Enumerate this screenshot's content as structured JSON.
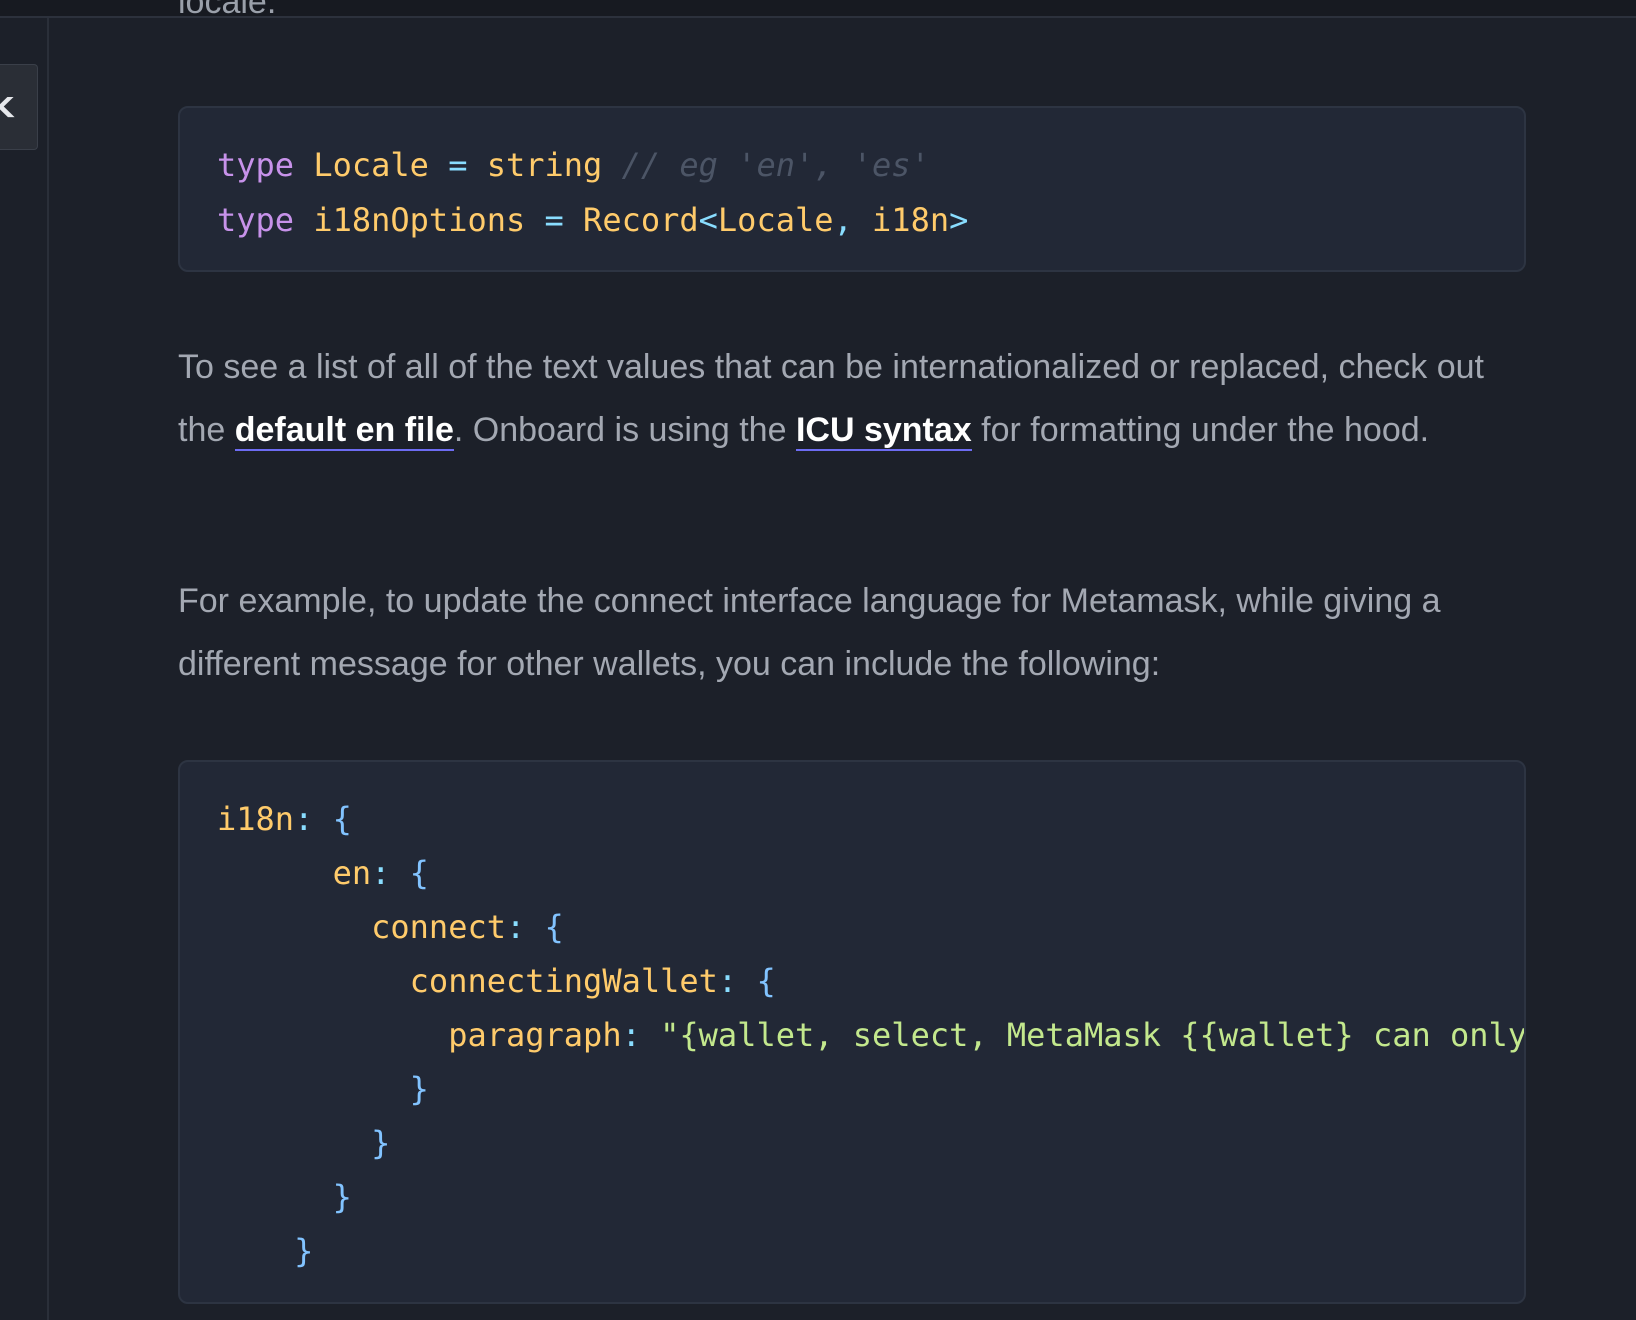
{
  "page": {
    "cut_off_text": "locale.",
    "side_tab_label": "K"
  },
  "code_block_1": {
    "line1": {
      "kw": "type",
      "name": "Locale",
      "op": "=",
      "type": "string",
      "comment": "// eg 'en', 'es'"
    },
    "line2": {
      "kw": "type",
      "name": "i18nOptions",
      "op": "=",
      "type": "Record",
      "lt": "<",
      "arg1": "Locale",
      "comma": ",",
      "arg2": "i18n",
      "gt": ">"
    }
  },
  "paragraph_1": {
    "text_before": "To see a list of all of the text values that can be internationalized or replaced, check out the ",
    "link_1": "default en file",
    "text_middle": ". Onboard is using the ",
    "link_2": "ICU syntax",
    "text_after": " for formatting under the hood."
  },
  "paragraph_2": {
    "text": "For example, to update the connect interface language for Metamask, while giving a different message for other wallets, you can include the following:"
  },
  "code_block_2": {
    "k_i18n": "i18n",
    "k_en": "en",
    "k_connect": "connect",
    "k_connecting": "connectingWallet",
    "k_paragraph": "paragraph",
    "colon": ":",
    "open_brace": "{",
    "close_brace": "}",
    "paragraph_value": "\"{wallet, select, MetaMask {{wallet} can only"
  },
  "colors": {
    "background": "#1c2029",
    "code_background": "#222836",
    "link_underline": "#6d6cf2",
    "keyword": "#c792ea",
    "type": "#ffcb6b",
    "string": "#c3e88d"
  }
}
